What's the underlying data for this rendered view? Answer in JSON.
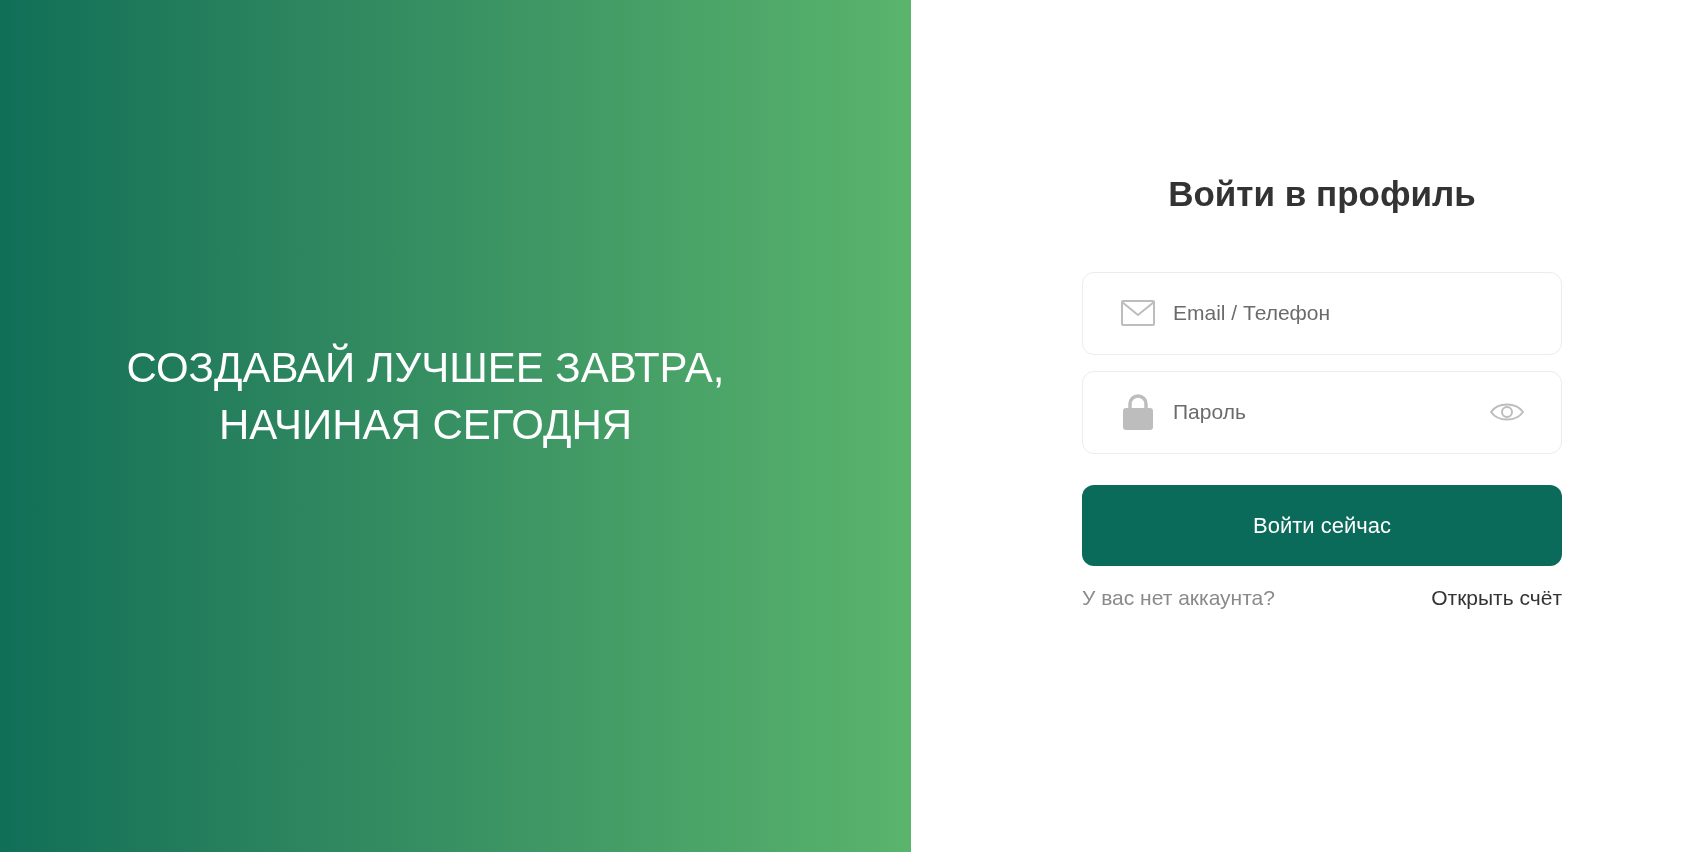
{
  "hero": {
    "lines": [
      "СОЗДАВАЙ ЛУЧШЕЕ ЗАВТРА,",
      "НАЧИНАЯ СЕГОДНЯ"
    ]
  },
  "form": {
    "title": "Войти в профиль",
    "fields": [
      {
        "kind": "email",
        "placeholder": "Email / Телефон"
      },
      {
        "kind": "password",
        "placeholder": "Пароль"
      }
    ],
    "submit": "Войти сейчас",
    "prompt": "У вас нет аккаунта?",
    "link": "Открыть счёт"
  }
}
